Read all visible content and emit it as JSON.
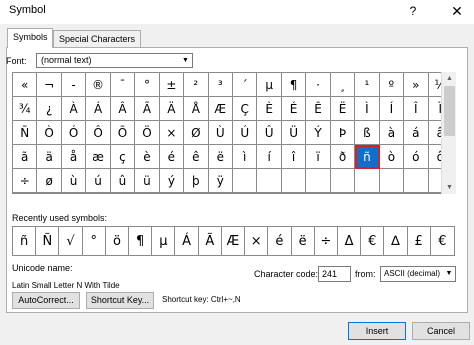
{
  "window": {
    "title": "Symbol",
    "help": "?",
    "close": "✕"
  },
  "tabs": [
    {
      "label": "Symbols"
    },
    {
      "label": "Special Characters"
    }
  ],
  "font": {
    "label": "Font:",
    "value": "(normal text)",
    "arrow": "▼"
  },
  "grid": {
    "rows": [
      [
        "«",
        "¬",
        "-",
        "®",
        "¯",
        "°",
        "±",
        "²",
        "³",
        "´",
        "µ",
        "¶",
        "·",
        "¸",
        "¹",
        "º",
        "»",
        "¼"
      ],
      [
        "¾",
        "¿",
        "À",
        "Á",
        "Â",
        "Ã",
        "Ä",
        "Å",
        "Æ",
        "Ç",
        "È",
        "É",
        "Ê",
        "Ë",
        "Ì",
        "Í",
        "Î",
        "Ï"
      ],
      [
        "Ñ",
        "Ò",
        "Ó",
        "Ô",
        "Õ",
        "Ö",
        "×",
        "Ø",
        "Ù",
        "Ú",
        "Û",
        "Ü",
        "Ý",
        "Þ",
        "ß",
        "à",
        "á",
        "â"
      ],
      [
        "ã",
        "ä",
        "å",
        "æ",
        "ç",
        "è",
        "é",
        "ê",
        "ë",
        "ì",
        "í",
        "î",
        "ï",
        "ð",
        "ñ",
        "ò",
        "ó",
        "ô"
      ],
      [
        "÷",
        "ø",
        "ù",
        "ú",
        "û",
        "ü",
        "ý",
        "þ",
        "ÿ",
        "",
        "",
        "",
        "",
        "",
        "",
        "",
        "",
        ""
      ]
    ],
    "selected": {
      "row": 3,
      "col": 14
    }
  },
  "scrollbar": {
    "up": "▲",
    "down": "▼"
  },
  "recent": {
    "label": "Recently used symbols:",
    "symbols": [
      "ñ",
      "Ñ",
      "√",
      "°",
      "ö",
      "¶",
      "µ",
      "Á",
      "Ã",
      "Æ",
      "×",
      "é",
      "ë",
      "÷",
      "Δ",
      "€",
      "∆",
      "£",
      "€"
    ]
  },
  "unicode": {
    "label": "Unicode name:",
    "value": "Latin Small Letter N With Tilde"
  },
  "character_code": {
    "label": "Character code:",
    "value": "241"
  },
  "from": {
    "label": "from:",
    "value": "ASCII (decimal)",
    "arrow": "▼"
  },
  "buttons": {
    "autocorrect": "AutoCorrect...",
    "shortcut_key": "Shortcut Key...",
    "insert": "Insert",
    "cancel": "Cancel"
  },
  "shortcut_text": "Shortcut key: Ctrl+~,N",
  "colors": {
    "selected_bg": "#0e6fd0",
    "selected_border": "#d82020",
    "accent": "#0078d7"
  }
}
